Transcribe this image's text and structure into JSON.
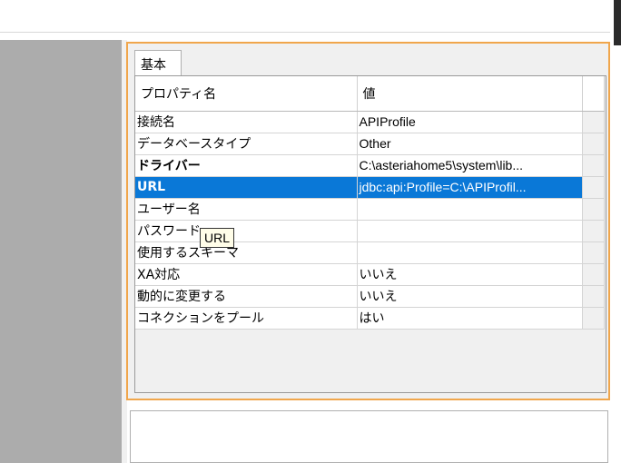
{
  "panel": {
    "tab_label": "基本",
    "columns": {
      "name": "プロパティ名",
      "value": "値"
    },
    "rows": [
      {
        "name": "接続名",
        "value": "APIProfile",
        "bold": false,
        "selected": false
      },
      {
        "name": "データベースタイプ",
        "value": "Other",
        "bold": false,
        "selected": false
      },
      {
        "name": "ドライバー",
        "value": "C:\\asteriahome5\\system\\lib...",
        "bold": true,
        "selected": false
      },
      {
        "name": "URL",
        "value": "jdbc:api:Profile=C:\\APIProfil...",
        "bold": true,
        "selected": true
      },
      {
        "name": "ユーザー名",
        "value": "",
        "bold": false,
        "selected": false
      },
      {
        "name": "パスワード",
        "value": "",
        "bold": false,
        "selected": false
      },
      {
        "name": "使用するスキーマ",
        "value": "",
        "bold": false,
        "selected": false
      },
      {
        "name": "XA対応",
        "value": "いいえ",
        "bold": false,
        "selected": false
      },
      {
        "name": "動的に変更する",
        "value": "いいえ",
        "bold": false,
        "selected": false
      },
      {
        "name": "コネクションをプール",
        "value": "はい",
        "bold": false,
        "selected": false
      }
    ],
    "tooltip": "URL"
  },
  "colors": {
    "selection": "#0a78d7",
    "panel_border": "#f0a64c",
    "left_pane": "#acacac"
  }
}
